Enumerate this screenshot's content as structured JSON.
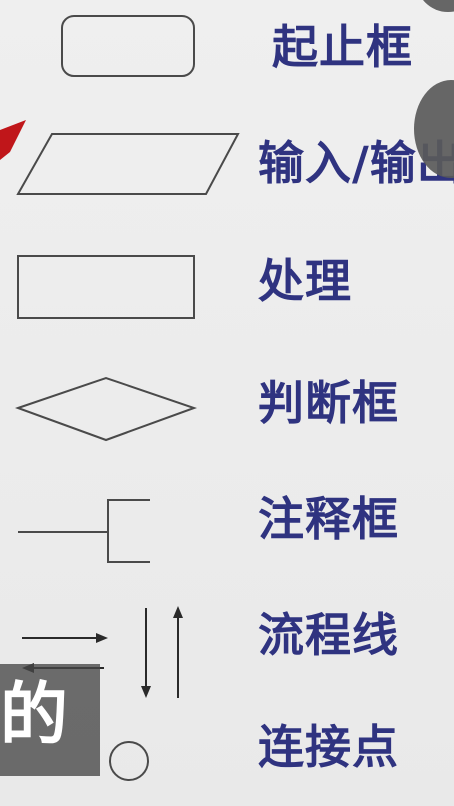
{
  "flowchart_symbols": [
    {
      "id": "start-end",
      "label": "起止框",
      "icon": "rounded-rectangle-icon"
    },
    {
      "id": "input-output",
      "label": "输入/输出",
      "icon": "parallelogram-icon"
    },
    {
      "id": "process",
      "label": "处理",
      "icon": "rectangle-icon"
    },
    {
      "id": "decision",
      "label": "判断框",
      "icon": "diamond-icon"
    },
    {
      "id": "annotation",
      "label": "注释框",
      "icon": "annotation-bracket-icon"
    },
    {
      "id": "flow-line",
      "label": "流程线",
      "icon": "flow-arrows-icon"
    },
    {
      "id": "connector",
      "label": "连接点",
      "icon": "circle-icon"
    }
  ],
  "subtitle": {
    "text": "的"
  },
  "colors": {
    "label": "#2f3380",
    "stroke": "#4a4a4a",
    "pointer": "#c0161a",
    "overlay": "#464646"
  }
}
